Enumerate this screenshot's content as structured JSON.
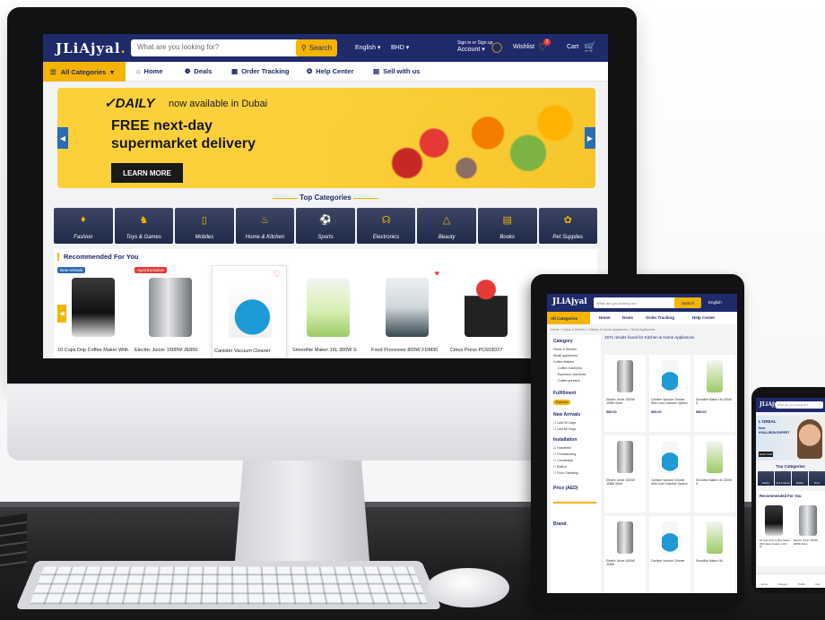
{
  "desktop": {
    "logo": "JLiAjyal",
    "search": {
      "placeholder": "What are you looking for?",
      "button_label": "Search"
    },
    "language": "English",
    "currency": "BHD",
    "account": {
      "line1": "Sign in or Sign up",
      "line2": "Account"
    },
    "wishlist": {
      "label": "Wishlist",
      "count": "2"
    },
    "cart_label": "Cart",
    "nav": {
      "all_categories": "All Categories",
      "items": [
        {
          "label": "Home",
          "icon": "home-icon"
        },
        {
          "label": "Deals",
          "icon": "deals-icon"
        },
        {
          "label": "Order Tracking",
          "icon": "tracking-icon"
        },
        {
          "label": "Help Center",
          "icon": "help-icon"
        },
        {
          "label": "Sell with us",
          "icon": "sell-icon"
        }
      ]
    },
    "banner": {
      "brand": "DAILY",
      "subtitle": "now available in Dubai",
      "headline_line1": "FREE next-day",
      "headline_line2": "supermarket delivery",
      "button": "LEARN MORE"
    },
    "top_categories": {
      "title": "Top Categories",
      "items": [
        "Fashion",
        "Toys & Games",
        "Mobiles",
        "Home & Kitchen",
        "Sports",
        "Electronics",
        "Beauty",
        "Books",
        "Pet Supplies"
      ]
    },
    "recommended": {
      "title": "Recommended For You",
      "products": [
        {
          "name": "10 Cups Drip Coffee Maker With",
          "tag": "New Arrivals"
        },
        {
          "name": "Electric Juicer 1500W JE850",
          "tag": "Ajyal Exclusive"
        },
        {
          "name": "Canister Vacuum Cleaner",
          "tag": ""
        },
        {
          "name": "Smoothie Maker 16L 300W S",
          "tag": ""
        },
        {
          "name": "Food Processor 800W FDM30",
          "tag": ""
        },
        {
          "name": "Citrus Press PC603D27",
          "tag": ""
        }
      ]
    },
    "colors": {
      "brand_navy": "#1f2a6b",
      "accent_yellow": "#f4b400",
      "heart_red": "#e53935"
    }
  },
  "tablet": {
    "logo": "JLiAjyal",
    "search_placeholder": "What are you looking for?",
    "search_button": "Search",
    "language": "English",
    "nav": [
      "All Categories",
      "Home",
      "Deals",
      "Order Tracking",
      "Help Center"
    ],
    "breadcrumb": "Home > Home & Kitchen > Kitchen & Home Appliances > Small Appliances",
    "results_text": "1671 results found for Kitchen & Home Appliances",
    "sidebar": {
      "category_title": "Category",
      "categories": [
        "Home & Kitchen",
        "Small appliances",
        "Coffee Makers",
        "Coffee machines",
        "Espresso machines",
        "Coffee grinders"
      ],
      "fulfillment_title": "Fulfillment",
      "fulfillment_badge": "Express",
      "new_arrivals_title": "New Arrivals",
      "new_arrivals": [
        "Last 30 Days",
        "Last 60 Days"
      ],
      "installation_title": "Installation",
      "installation": [
        "Handheld",
        "Freestanding",
        "Countertop",
        "Built-in",
        "Floor Standing"
      ],
      "price_title": "Price (AED)",
      "brand_title": "Brand"
    },
    "products": [
      {
        "name": "Electric Juicer 1500W JE850 Silver",
        "price": "589.00"
      },
      {
        "name": "Canister Vacuum Cleaner With Dust Chamber System",
        "price": "589.00"
      },
      {
        "name": "Smoothie Maker 16L 300W S",
        "price": "589.00"
      },
      {
        "name": "Electric Juicer 1500W JE850 Silver",
        "price": ""
      },
      {
        "name": "Canister Vacuum Cleaner With Dust Chamber System",
        "price": ""
      },
      {
        "name": "Smoothie Maker 16L 300W S",
        "price": ""
      },
      {
        "name": "Electric Juicer 1500W JE850",
        "price": ""
      },
      {
        "name": "Canister Vacuum Cleaner",
        "price": ""
      },
      {
        "name": "Smoothie Maker 16L",
        "price": ""
      }
    ]
  },
  "phone": {
    "logo": "JLiAjyal",
    "search_placeholder": "What are you looking for?",
    "banner": {
      "brand": "L'OREAL",
      "line1": "New",
      "line2": "HYALURON EXPERT",
      "button": "SHOP NOW"
    },
    "top_categories_title": "Top Categories",
    "categories": [
      "Fashion",
      "Toys & Games",
      "Mobiles",
      "Home"
    ],
    "recommended_title": "Recommended For You",
    "products": [
      {
        "name": "10 Cups Drip Coffee Maker With Glass Carafe 1.25L B..."
      },
      {
        "name": "Electric Juicer 1500W JE850 Silver"
      }
    ],
    "bottom_nav": [
      "Home",
      "Category",
      "Profile",
      "Cart"
    ]
  }
}
